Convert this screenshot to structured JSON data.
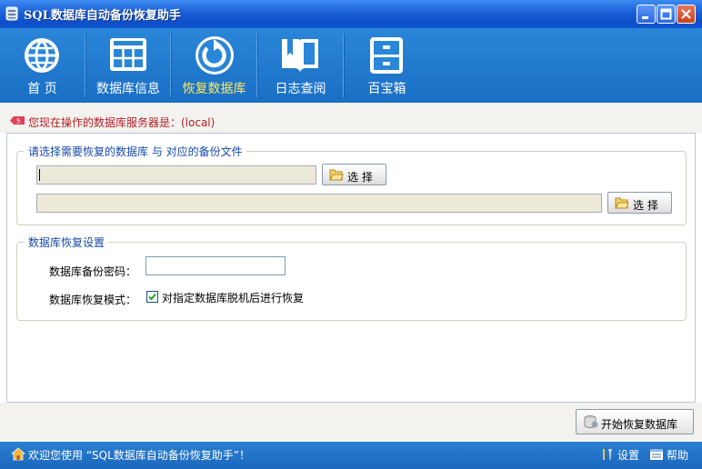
{
  "window": {
    "title": "SQL数据库自动备份恢复助手"
  },
  "toolbar": {
    "items": [
      {
        "label": "首  页",
        "icon": "globe-icon"
      },
      {
        "label": "数据库信息",
        "icon": "database-table-icon"
      },
      {
        "label": "恢复数据库",
        "icon": "restore-icon"
      },
      {
        "label": "日志查阅",
        "icon": "book-icon"
      },
      {
        "label": "百宝箱",
        "icon": "cabinet-icon"
      }
    ],
    "active_index": 2
  },
  "info": {
    "text": "您现在操作的数据库服务器是：(local)"
  },
  "restore_group": {
    "legend": "请选择需要恢复的数据库 与 对应的备份文件",
    "database_value": "",
    "backup_file_value": "",
    "choose_label": "选 择"
  },
  "settings_group": {
    "legend": "数据库恢复设置",
    "password_label": "数据库备份密码：",
    "password_value": "",
    "mode_label": "数据库恢复模式：",
    "mode_checkbox_label": "对指定数据库脱机后进行恢复",
    "mode_checked": true
  },
  "actions": {
    "start_label": "开始恢复数据库"
  },
  "status": {
    "welcome": "欢迎您使用 “SQL数据库自动备份恢复助手”！",
    "settings_label": "设置",
    "help_label": "帮助"
  },
  "colors": {
    "titlebar": "#1a5ed8",
    "toolbar": "#1f77cc",
    "active_label": "#ffe95a",
    "info_text": "#b3202a",
    "legend_text": "#1649a8"
  }
}
